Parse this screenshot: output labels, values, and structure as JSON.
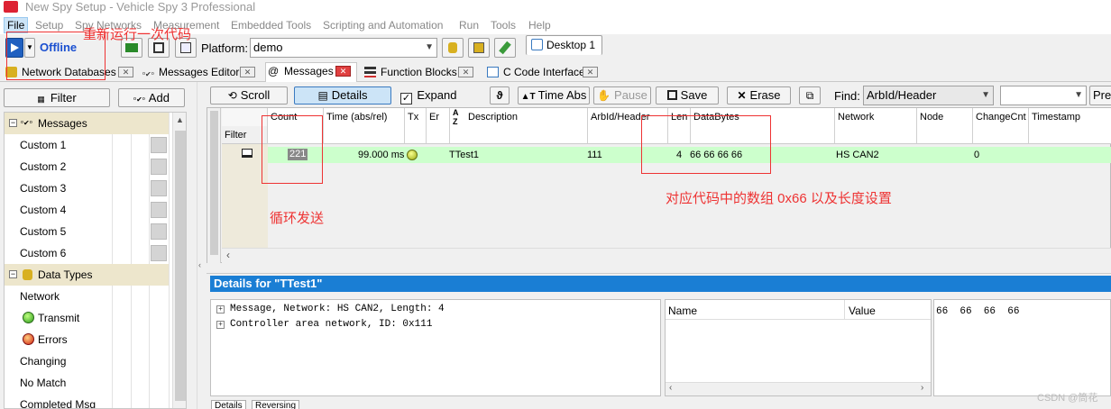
{
  "window": {
    "title": "New Spy Setup - Vehicle Spy 3 Professional"
  },
  "menu": [
    "File",
    "Setup",
    "Spy Networks",
    "Measurement",
    "Embedded Tools",
    "Scripting and Automation",
    "Run",
    "Tools",
    "Help"
  ],
  "toolbar": {
    "status": "Offline",
    "platform_label": "Platform:",
    "platform_value": "demo",
    "desktop_tab": "Desktop 1"
  },
  "tabs": [
    "Network Databases",
    "Messages Editor",
    "Messages",
    "Function Blocks",
    "C Code Interface"
  ],
  "left": {
    "filter_label": "Filter",
    "add_label": "Add",
    "tree": [
      {
        "label": "Messages",
        "group": true
      },
      {
        "label": "Custom 1"
      },
      {
        "label": "Custom 2"
      },
      {
        "label": "Custom 3"
      },
      {
        "label": "Custom 4"
      },
      {
        "label": "Custom 5"
      },
      {
        "label": "Custom 6"
      },
      {
        "label": "Data Types",
        "group": true
      },
      {
        "label": "Network"
      },
      {
        "label": "Transmit"
      },
      {
        "label": "Errors"
      },
      {
        "label": "Changing"
      },
      {
        "label": "No Match"
      },
      {
        "label": "Completed Msg"
      }
    ]
  },
  "msgtoolbar": {
    "scroll": "Scroll",
    "details": "Details",
    "expand": "Expand",
    "time_abs": "Time Abs",
    "pause": "Pause",
    "save": "Save",
    "erase": "Erase",
    "find_label": "Find:",
    "find_value": "ArbId/Header",
    "prev": "Prev"
  },
  "grid": {
    "columns": [
      "Count",
      "Time (abs/rel)",
      "Tx",
      "Er",
      "Description",
      "ArbId/Header",
      "Len",
      "DataBytes",
      "Network",
      "Node",
      "ChangeCnt",
      "Timestamp"
    ],
    "filter_label": "Filter",
    "row": {
      "count": "221",
      "time": "99.000 ms",
      "description": "TTest1",
      "arbid": "111",
      "len": "4",
      "databytes": "66 66 66 66",
      "network": "HS CAN2",
      "changecnt": "0"
    }
  },
  "annotations": {
    "rerun": "重新运行一次代码",
    "loop": "循环发送",
    "array": "对应代码中的数组 0x66 以及长度设置"
  },
  "details": {
    "header": "Details for \"TTest1\"",
    "lines": [
      "Message, Network: HS CAN2, Length: 4",
      "Controller area network, ID: 0x111"
    ],
    "name_col": "Name",
    "value_col": "Value",
    "bytes": "66  66  66  66",
    "bottom_tabs": [
      "Details",
      "Reversing"
    ]
  },
  "watermark": "CSDN @筒花",
  "colors": {
    "accent_blue": "#1a7ed4",
    "row_green": "#ccffcc",
    "annotation_red": "#ee3333"
  }
}
